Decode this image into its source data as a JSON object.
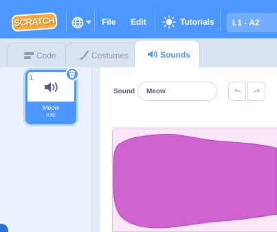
{
  "menubar": {
    "logo_text": "SCRATCH",
    "file_label": "File",
    "edit_label": "Edit",
    "tutorials_label": "Tutorials",
    "project_title": "L1 - A2"
  },
  "tabs": [
    {
      "id": "code",
      "label": "Code",
      "icon": "code-blocks-icon",
      "active": false
    },
    {
      "id": "costumes",
      "label": "Costumes",
      "icon": "brush-icon",
      "active": false
    },
    {
      "id": "sounds",
      "label": "Sounds",
      "icon": "speaker-icon",
      "active": true
    }
  ],
  "sound_list": [
    {
      "number": "1",
      "name": "Meow",
      "duration": "0.85",
      "selected": true
    }
  ],
  "editor": {
    "sound_label": "Sound",
    "sound_name_value": "Meow"
  },
  "colors": {
    "accent": "#4c97ff",
    "waveform_fill": "#cf63cf",
    "waveform_bg": "#f9e6f7"
  }
}
